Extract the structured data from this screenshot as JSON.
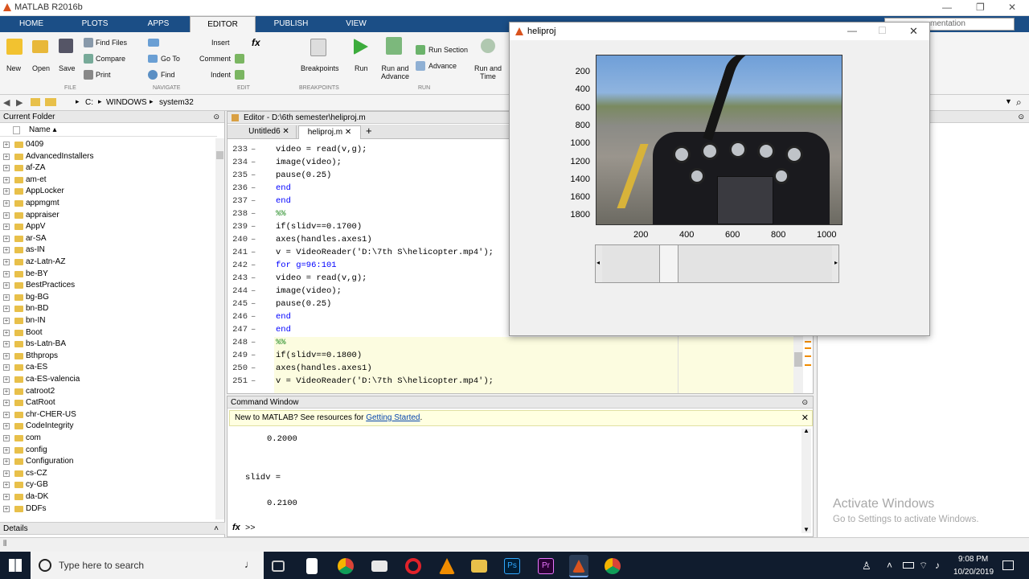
{
  "window": {
    "title": "MATLAB R2016b",
    "search_placeholder": "mentation"
  },
  "tabs": [
    "HOME",
    "PLOTS",
    "APPS",
    "EDITOR",
    "PUBLISH",
    "VIEW"
  ],
  "ribbon": {
    "new": "New",
    "open": "Open",
    "save": "Save",
    "find_files": "Find Files",
    "compare": "Compare",
    "print": "Print",
    "go_to": "Go To",
    "find": "Find",
    "insert": "Insert",
    "comment": "Comment",
    "indent": "Indent",
    "breakpoints": "Breakpoints",
    "run": "Run",
    "run_advance_1": "Run and",
    "run_advance_2": "Advance",
    "run_section": "Run Section",
    "advance": "Advance",
    "run_time_1": "Run and",
    "run_time_2": "Time",
    "groups": {
      "file": "FILE",
      "navigate": "NAVIGATE",
      "edit": "EDIT",
      "breakpoints": "BREAKPOINTS",
      "run": "RUN"
    }
  },
  "address": [
    "C:",
    "WINDOWS",
    "system32"
  ],
  "current_folder": {
    "title": "Current Folder",
    "col_name": "Name ▴",
    "items": [
      "0409",
      "AdvancedInstallers",
      "af-ZA",
      "am-et",
      "AppLocker",
      "appmgmt",
      "appraiser",
      "AppV",
      "ar-SA",
      "as-IN",
      "az-Latn-AZ",
      "be-BY",
      "BestPractices",
      "bg-BG",
      "bn-BD",
      "bn-IN",
      "Boot",
      "bs-Latn-BA",
      "Bthprops",
      "ca-ES",
      "ca-ES-valencia",
      "catroot2",
      "CatRoot",
      "chr-CHER-US",
      "CodeIntegrity",
      "com",
      "config",
      "Configuration",
      "cs-CZ",
      "cy-GB",
      "da-DK",
      "DDFs"
    ],
    "details": "Details"
  },
  "editor": {
    "title": "Editor - D:\\6th semester\\heliproj.m",
    "tabs": [
      "Untitled6",
      "heliproj.m",
      "+"
    ],
    "lines": [
      {
        "n": "233",
        "c": "video = read(v,g);"
      },
      {
        "n": "234",
        "c": "image(video);"
      },
      {
        "n": "235",
        "c": "pause(0.25)"
      },
      {
        "n": "236",
        "c": "end"
      },
      {
        "n": "237",
        "c": "end"
      },
      {
        "n": "238",
        "c": "%%"
      },
      {
        "n": "239",
        "c": "if(slidv==0.1700)"
      },
      {
        "n": "240",
        "c": "axes(handles.axes1)"
      },
      {
        "n": "241",
        "c": "v = VideoReader('D:\\7th S\\helicopter.mp4');"
      },
      {
        "n": "242",
        "c": "for g=96:101"
      },
      {
        "n": "243",
        "c": "video = read(v,g);"
      },
      {
        "n": "244",
        "c": "image(video);"
      },
      {
        "n": "245",
        "c": "pause(0.25)"
      },
      {
        "n": "246",
        "c": "end"
      },
      {
        "n": "247",
        "c": "end"
      },
      {
        "n": "248",
        "c": "%%"
      },
      {
        "n": "249",
        "c": "if(slidv==0.1800)"
      },
      {
        "n": "250",
        "c": "axes(handles.axes1)"
      },
      {
        "n": "251",
        "c": "v = VideoReader('D:\\7th S\\helicopter.mp4');"
      }
    ]
  },
  "command": {
    "title": "Command Window",
    "banner": "New to MATLAB? See resources for ",
    "banner_link": "Getting Started",
    "banner_end": ".",
    "out1": "0.2000",
    "var": "slidv =",
    "out2": "0.2100",
    "prompt": ">>",
    "fx": "fx"
  },
  "figure": {
    "title": "heliproj",
    "yticks": [
      "200",
      "400",
      "600",
      "800",
      "1000",
      "1200",
      "1400",
      "1600",
      "1800"
    ],
    "xticks": [
      "200",
      "400",
      "600",
      "800",
      "1000"
    ],
    "slider_value": 0.27
  },
  "watermark": {
    "line1": "Activate Windows",
    "line2": "Go to Settings to activate Windows."
  },
  "taskbar": {
    "search": "Type here to search",
    "time": "9:08 PM",
    "date": "10/20/2019"
  }
}
